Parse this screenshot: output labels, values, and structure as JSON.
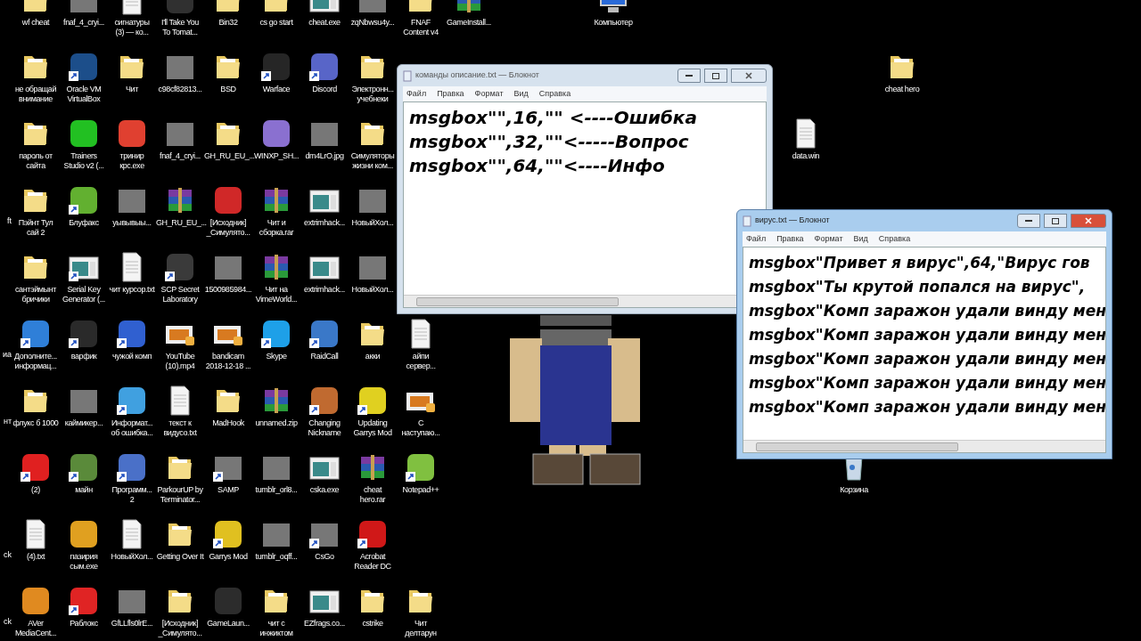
{
  "desktop": {
    "columns": [
      [
        null,
        null,
        null,
        {
          "label": "ft",
          "kind": "cut"
        },
        null,
        {
          "label": "иа",
          "kind": "cut"
        },
        {
          "label": "нт",
          "kind": "cut"
        },
        null,
        {
          "label": "ck",
          "kind": "cut"
        },
        {
          "label": "ck",
          "kind": "cut"
        }
      ],
      [
        {
          "label": "wf cheat",
          "kind": "folder",
          "shortcut": false
        },
        {
          "label": "не обращай внимание",
          "kind": "folder",
          "shortcut": false
        },
        {
          "label": "пароль от сайта",
          "kind": "folder",
          "shortcut": false
        },
        {
          "label": "Пэйнт Тул сай 2",
          "kind": "folder",
          "shortcut": false
        },
        {
          "label": "сантэймынт бричики",
          "kind": "folder",
          "shortcut": false
        },
        {
          "label": "Дополните...\nинформац...",
          "kind": "app",
          "color": "#2f7fd8",
          "shortcut": true
        },
        {
          "label": "флукс б 1000",
          "kind": "folder",
          "shortcut": false
        },
        {
          "label": "(2)",
          "kind": "app",
          "color": "#e02020",
          "shortcut": true
        },
        {
          "label": "(4).txt",
          "kind": "text",
          "shortcut": false
        },
        {
          "label": "AVer\nMediaCent...",
          "kind": "app",
          "color": "#e08a20",
          "shortcut": false
        }
      ],
      [
        {
          "label": "fnaf_4_cryi...",
          "kind": "photo",
          "shortcut": false
        },
        {
          "label": "Oracle VM VirtualBox",
          "kind": "app",
          "color": "#1c4e8a",
          "shortcut": true
        },
        {
          "label": "Trainers\nStudio v2 (...",
          "kind": "app",
          "color": "#22c022",
          "shortcut": false
        },
        {
          "label": "Блуфакс",
          "kind": "app",
          "color": "#62b030",
          "shortcut": true
        },
        {
          "label": "Serial Key\nGenerator (...",
          "kind": "window",
          "shortcut": true
        },
        {
          "label": "варфик",
          "kind": "app",
          "color": "#2a2a2a",
          "shortcut": true
        },
        {
          "label": "каймикер...",
          "kind": "photo",
          "shortcut": false
        },
        {
          "label": "майн",
          "kind": "app",
          "color": "#5a8a3a",
          "shortcut": true
        },
        {
          "label": "пазирия сым.exe",
          "kind": "app",
          "color": "#e0a020",
          "shortcut": false
        },
        {
          "label": "Раблокс",
          "kind": "app",
          "color": "#e02424",
          "shortcut": true
        }
      ],
      [
        {
          "label": "сигнатуры\n(3) — ко...",
          "kind": "text",
          "shortcut": false
        },
        {
          "label": "Чит",
          "kind": "folder",
          "shortcut": false
        },
        {
          "label": "тринир крс.exe",
          "kind": "app",
          "color": "#e04030",
          "shortcut": false
        },
        {
          "label": "уывывыы...",
          "kind": "photo",
          "shortcut": false
        },
        {
          "label": "чит курсор.txt",
          "kind": "text",
          "shortcut": false
        },
        {
          "label": "чужой комп",
          "kind": "app",
          "color": "#3060d0",
          "shortcut": true
        },
        {
          "label": "Информат...\nоб ошибка...",
          "kind": "app",
          "color": "#40a0e0",
          "shortcut": true
        },
        {
          "label": "Программ...\n2",
          "kind": "app",
          "color": "#4a70c8",
          "shortcut": true
        },
        {
          "label": "НовыйХол...",
          "kind": "text",
          "shortcut": false
        },
        {
          "label": "GfLLfls0lrE...",
          "kind": "photo",
          "shortcut": false
        }
      ],
      [
        {
          "label": "I'll Take You\nTo Tomat...",
          "kind": "app",
          "color": "#303030",
          "shortcut": false
        },
        {
          "label": "c98cf82813...",
          "kind": "photo",
          "shortcut": false
        },
        {
          "label": "fnaf_4_cryi...",
          "kind": "photo",
          "shortcut": false
        },
        {
          "label": "GH_RU_EU_...",
          "kind": "archive",
          "shortcut": false
        },
        {
          "label": "SCP Secret Laboratory",
          "kind": "app",
          "color": "#3a3a3a",
          "shortcut": true
        },
        {
          "label": "YouTube\n(10).mp4",
          "kind": "media",
          "shortcut": false
        },
        {
          "label": "текст к видусо.txt",
          "kind": "text",
          "shortcut": false
        },
        {
          "label": "ParkourUP by\nTerminator...",
          "kind": "folder",
          "shortcut": false
        },
        {
          "label": "Getting Over It",
          "kind": "folder",
          "shortcut": false
        },
        {
          "label": "[Исходник]\n_Симулято...",
          "kind": "folder",
          "shortcut": false
        }
      ],
      [
        {
          "label": "Bin32",
          "kind": "folder",
          "shortcut": false
        },
        {
          "label": "BSD",
          "kind": "folder",
          "shortcut": false
        },
        {
          "label": "GH_RU_EU_...",
          "kind": "folder",
          "shortcut": false
        },
        {
          "label": "[Исходник]\n_Симулято...",
          "kind": "app",
          "color": "#d02828",
          "shortcut": false
        },
        {
          "label": "1500985984...",
          "kind": "photo",
          "shortcut": false
        },
        {
          "label": "bandicam\n2018-12-18 ...",
          "kind": "media",
          "shortcut": false
        },
        {
          "label": "MadHook",
          "kind": "folder",
          "shortcut": false
        },
        {
          "label": "SAMP",
          "kind": "photo",
          "shortcut": true
        },
        {
          "label": "Garrys Mod",
          "kind": "app",
          "color": "#e0c020",
          "shortcut": true
        },
        {
          "label": "GameLaun...",
          "kind": "app",
          "color": "#2c2c2c",
          "shortcut": false
        }
      ],
      [
        {
          "label": "cs go start",
          "kind": "folder",
          "shortcut": false
        },
        {
          "label": "Warface",
          "kind": "app",
          "color": "#262626",
          "shortcut": true
        },
        {
          "label": "WINXP_SH...",
          "kind": "app",
          "color": "#8a70d0",
          "shortcut": false
        },
        {
          "label": "Чит и\nсборка.rar",
          "kind": "archive",
          "shortcut": false
        },
        {
          "label": "Чит на\nVimeWorld...",
          "kind": "archive",
          "shortcut": false
        },
        {
          "label": "Skype",
          "kind": "app",
          "color": "#1ea0e8",
          "shortcut": true
        },
        {
          "label": "unnamed.zip",
          "kind": "archive",
          "shortcut": false
        },
        {
          "label": "tumblr_orl8...",
          "kind": "photo",
          "shortcut": false
        },
        {
          "label": "tumblr_oqff...",
          "kind": "photo",
          "shortcut": false
        },
        {
          "label": "чит с инжиктом",
          "kind": "folder",
          "shortcut": false
        }
      ],
      [
        {
          "label": "cheat.exe",
          "kind": "window",
          "shortcut": false
        },
        {
          "label": "Discord",
          "kind": "app",
          "color": "#5865c8",
          "shortcut": true
        },
        {
          "label": "dm4LrO.jpg",
          "kind": "photo",
          "shortcut": false
        },
        {
          "label": "extrimhack...",
          "kind": "window",
          "shortcut": false
        },
        {
          "label": "extrimhack...",
          "kind": "window",
          "shortcut": false
        },
        {
          "label": "RaidCall",
          "kind": "app",
          "color": "#3a78c8",
          "shortcut": true
        },
        {
          "label": "Changing Nickname",
          "kind": "app",
          "color": "#c06a30",
          "shortcut": true
        },
        {
          "label": "cska.exe",
          "kind": "window",
          "shortcut": false
        },
        {
          "label": "CsGo",
          "kind": "photo",
          "shortcut": true
        },
        {
          "label": "EZfrags.co...",
          "kind": "window",
          "shortcut": false
        }
      ],
      [
        {
          "label": "zqNbwsu4y...",
          "kind": "photo",
          "shortcut": false
        },
        {
          "label": "Электронн...\nучебнеки",
          "kind": "folder",
          "shortcut": false
        },
        {
          "label": "Симуляторы\nжизни ком...",
          "kind": "folder",
          "shortcut": false
        },
        {
          "label": "НовыйХол...",
          "kind": "photo",
          "shortcut": false
        },
        {
          "label": "НовыйХол...",
          "kind": "photo",
          "shortcut": false
        },
        {
          "label": "акки",
          "kind": "folder",
          "shortcut": false
        },
        {
          "label": "Updating\nGarrys Mod",
          "kind": "app",
          "color": "#e0d020",
          "shortcut": true
        },
        {
          "label": "cheat\nhero.rar",
          "kind": "archive",
          "shortcut": false
        },
        {
          "label": "Acrobat\nReader DC",
          "kind": "app",
          "color": "#d01818",
          "shortcut": true
        },
        {
          "label": "cstrike",
          "kind": "folder",
          "shortcut": false
        }
      ],
      [
        {
          "label": "FNAF\nContent v4",
          "kind": "folder",
          "shortcut": false
        },
        null,
        null,
        null,
        null,
        {
          "label": "айпи\nсервер...",
          "kind": "text",
          "shortcut": false
        },
        {
          "label": "С\nнаступаю...",
          "kind": "media",
          "shortcut": false
        },
        {
          "label": "Notepad++",
          "kind": "app",
          "color": "#80c040",
          "shortcut": true
        },
        null,
        {
          "label": "Чит\nделтарун",
          "kind": "folder",
          "shortcut": false
        }
      ],
      [
        {
          "label": "GameInstall...",
          "kind": "archive",
          "shortcut": false
        }
      ]
    ],
    "other_icons": [
      {
        "label": "Компьютер",
        "kind": "computer",
        "shortcut": false
      },
      {
        "label": "data.win",
        "kind": "text",
        "shortcut": false
      },
      {
        "label": "Корзина",
        "kind": "bin",
        "shortcut": false
      },
      {
        "label": "cheat hero",
        "kind": "folder",
        "shortcut": false
      }
    ]
  },
  "windows": [
    {
      "title": "команды описание.txt — Блокнот",
      "active": false,
      "menu": [
        "Файл",
        "Правка",
        "Формат",
        "Вид",
        "Справка"
      ],
      "lines": [
        "msgbox\"\",16,\"\" <----Ошибка",
        "msgbox\"\",32,\"\"<-----Вопрос",
        "msgbox\"\",64,\"\"<----Инфо"
      ]
    },
    {
      "title": "вирус.txt — Блокнот",
      "active": true,
      "menu": [
        "Файл",
        "Правка",
        "Формат",
        "Вид",
        "Справка"
      ],
      "lines": [
        "msgbox\"Привет я вирус\",64,\"Вирус гов",
        "msgbox\"Ты крутой попался на вирус\",",
        "msgbox\"Комп заражон удали винду мен",
        "msgbox\"Комп заражон удали винду мен",
        "msgbox\"Комп заражон удали винду мен",
        "msgbox\"Комп заражон удали винду мен",
        "msgbox\"Комп заражон удали винду мен"
      ]
    }
  ]
}
